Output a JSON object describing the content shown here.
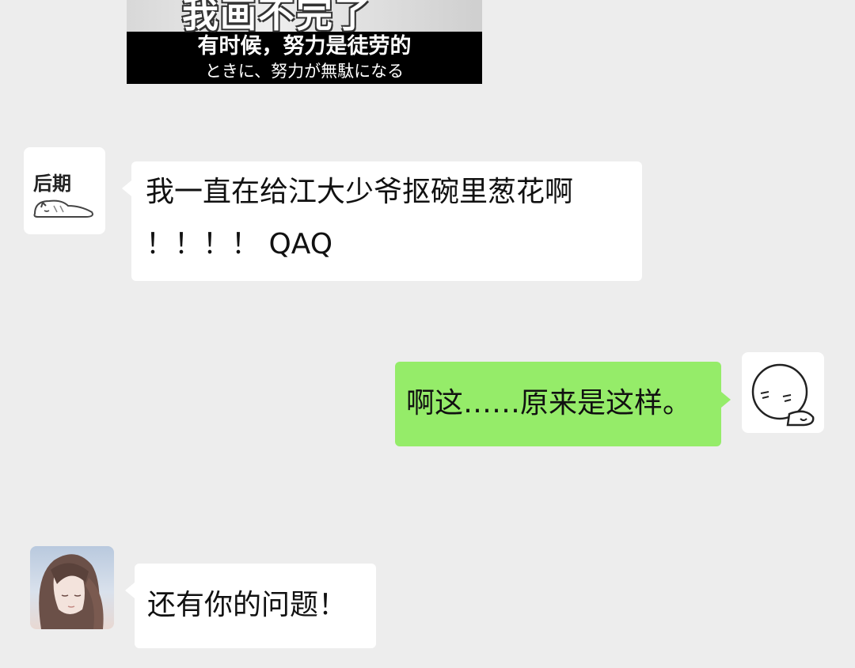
{
  "meme": {
    "art_text": "我画不完了",
    "caption_cn": "有时候，努力是徒劳的",
    "caption_jp": "ときに、努力が無駄になる"
  },
  "messages": [
    {
      "side": "left",
      "avatar_label": "后期",
      "lines": [
        "我一直在给江大少爷抠碗里葱花啊",
        "！！！！ QAQ"
      ]
    },
    {
      "side": "right",
      "lines": [
        "啊这……原来是这样。"
      ]
    },
    {
      "side": "left",
      "lines": [
        "还有你的问题！"
      ]
    }
  ],
  "colors": {
    "background": "#ededed",
    "incoming_bubble": "#ffffff",
    "outgoing_bubble": "#95ec69"
  }
}
